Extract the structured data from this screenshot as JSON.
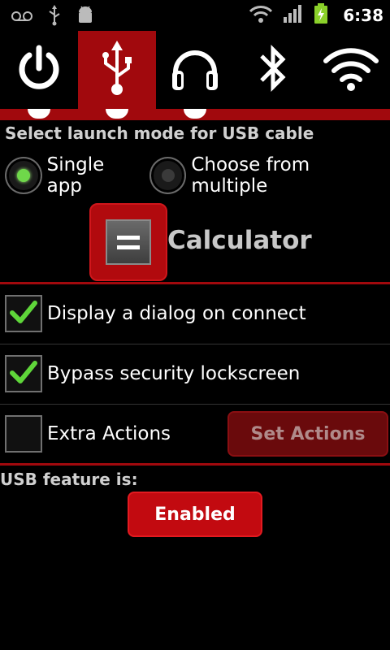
{
  "status_bar": {
    "time": "6:38",
    "left_icons": [
      "voicemail-icon",
      "usb-icon",
      "android-debug-icon"
    ],
    "right_icons": [
      "wifi-icon",
      "signal-icon",
      "battery-charging-icon"
    ]
  },
  "tabs": [
    {
      "name": "power",
      "icon": "power-icon",
      "active": false
    },
    {
      "name": "usb",
      "icon": "usb-icon",
      "active": true
    },
    {
      "name": "headphones",
      "icon": "headphones-icon",
      "active": false
    },
    {
      "name": "bluetooth",
      "icon": "bluetooth-icon",
      "active": false
    },
    {
      "name": "wifi",
      "icon": "wifi-icon",
      "active": false
    }
  ],
  "launch_mode": {
    "heading": "Select launch mode for USB cable",
    "options": [
      {
        "label": "Single app",
        "selected": true
      },
      {
        "label": "Choose from multiple",
        "selected": false
      }
    ]
  },
  "app": {
    "name": "Calculator",
    "icon": "calculator-icon"
  },
  "options": [
    {
      "label": "Display a dialog on connect",
      "checked": true
    },
    {
      "label": "Bypass security lockscreen",
      "checked": true
    },
    {
      "label": "Extra Actions",
      "checked": false
    }
  ],
  "set_actions_label": "Set Actions",
  "feature": {
    "label": "USB feature is:",
    "button_label": "Enabled"
  },
  "colors": {
    "accent_red": "#a1090d",
    "radio_on": "#6fd84a",
    "check_green": "#5fd63a"
  }
}
